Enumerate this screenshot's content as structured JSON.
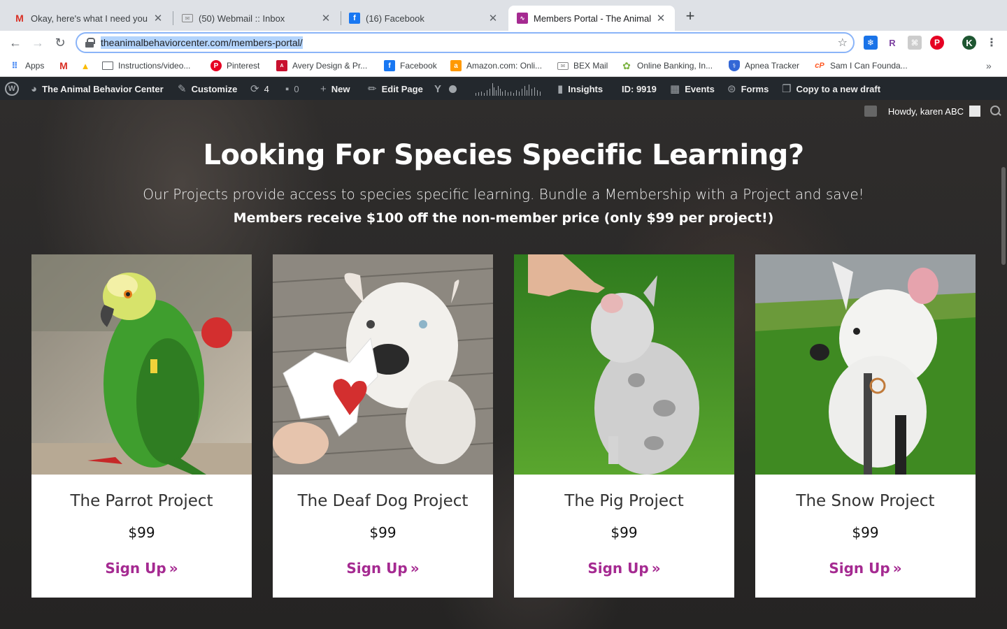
{
  "colors": {
    "accent": "#a52a91",
    "wpbar": "#23282d"
  },
  "tabs": [
    {
      "title": "Okay, here's what I need you to",
      "icon": "gmail-icon"
    },
    {
      "title": "(50) Webmail :: Inbox",
      "icon": "mail-icon"
    },
    {
      "title": "(16) Facebook",
      "icon": "facebook-icon"
    },
    {
      "title": "Members Portal - The Animal B",
      "icon": "site-icon"
    }
  ],
  "address": {
    "url": "theanimalbehaviorcenter.com/members-portal/"
  },
  "bookmarks": [
    {
      "label": "Apps"
    },
    {
      "label": ""
    },
    {
      "label": ""
    },
    {
      "label": "Instructions/video..."
    },
    {
      "label": "Pinterest"
    },
    {
      "label": "Avery Design & Pr..."
    },
    {
      "label": "Facebook"
    },
    {
      "label": "Amazon.com: Onli..."
    },
    {
      "label": "BEX Mail"
    },
    {
      "label": "Online Banking, In..."
    },
    {
      "label": "Apnea Tracker"
    },
    {
      "label": "Sam I Can Founda..."
    }
  ],
  "toolbar": {
    "profile_initial": "K",
    "ext_r": "R"
  },
  "wpbar": {
    "site": "The Animal Behavior Center",
    "customize": "Customize",
    "updates": "4",
    "comments": "0",
    "new": "New",
    "edit": "Edit Page",
    "insights": "Insights",
    "id": "ID: 9919",
    "events": "Events",
    "forms": "Forms",
    "copy": "Copy to a new draft",
    "howdy": "Howdy, karen ABC"
  },
  "hero": {
    "title": "Looking For Species Specific Learning?",
    "subtitle": "Our Projects provide access to species specific learning. Bundle a Membership with a Project and save!",
    "note": "Members receive $100 off the non-member price (only $99 per project!)"
  },
  "cards": [
    {
      "name": "The Parrot Project",
      "price": "$99",
      "cta": "Sign Up"
    },
    {
      "name": "The Deaf Dog Project",
      "price": "$99",
      "cta": "Sign Up"
    },
    {
      "name": "The Pig Project",
      "price": "$99",
      "cta": "Sign Up"
    },
    {
      "name": "The Snow Project",
      "price": "$99",
      "cta": "Sign Up"
    }
  ]
}
